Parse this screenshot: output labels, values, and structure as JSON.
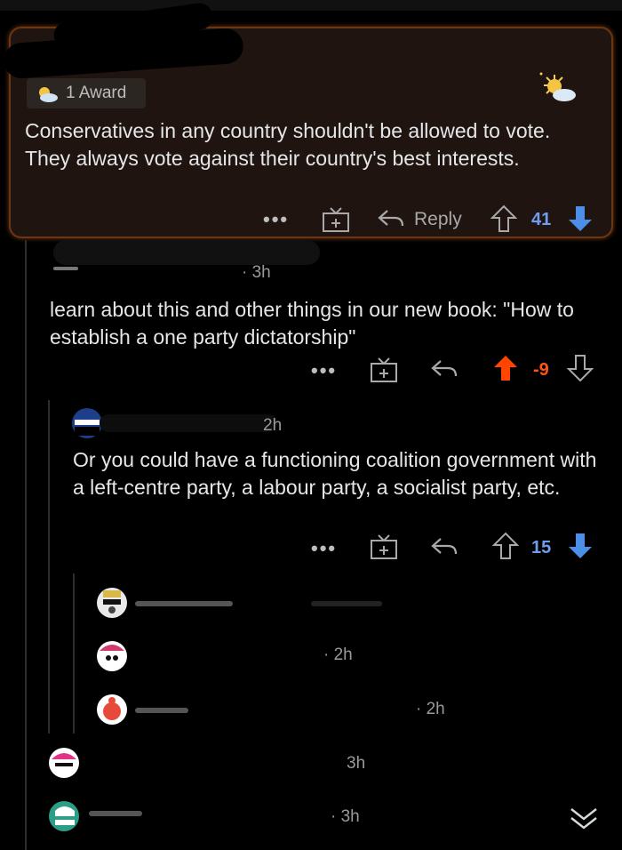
{
  "highlighted_comment": {
    "award_label": "1 Award",
    "text": "Conservatives in any country shouldn't be allowed to vote. They always vote against their country's best interests.",
    "more_label": "•••",
    "reply_label": "Reply",
    "score": "41"
  },
  "reply_1": {
    "time": "· 3h",
    "text": "learn about this and other things in our new book: \"How to establish a one party dictatorship\"",
    "more_label": "•••",
    "score": "-9"
  },
  "reply_2": {
    "time": "2h",
    "text": "Or you could have a functioning coalition government with a left-centre party, a labour party, a socialist party, etc.",
    "more_label": "•••",
    "score": "15"
  },
  "collapsed": [
    {
      "time": ""
    },
    {
      "time": "· 2h"
    },
    {
      "time": "· 2h"
    },
    {
      "time": "3h"
    },
    {
      "time": "· 3h"
    }
  ],
  "colors": {
    "upvote": "#ff4500",
    "downvote": "#4b8fe8",
    "score_blue": "#6f9ef0",
    "score_orange": "#ff5414"
  }
}
